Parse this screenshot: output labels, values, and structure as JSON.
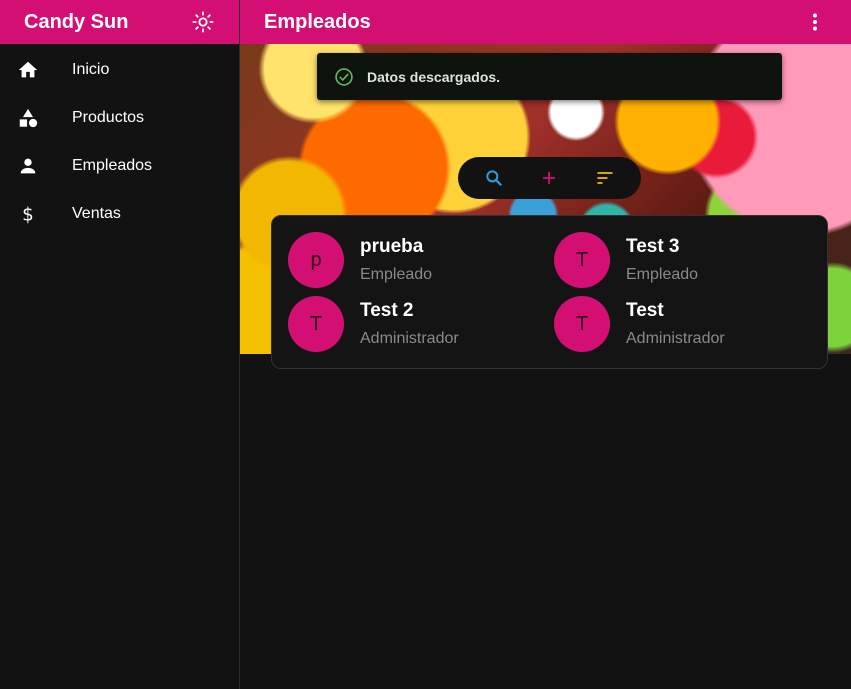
{
  "sidebar": {
    "brand": "Candy Sun",
    "items": [
      {
        "label": "Inicio",
        "icon": "home-icon"
      },
      {
        "label": "Productos",
        "icon": "shapes-icon"
      },
      {
        "label": "Empleados",
        "icon": "person-icon"
      },
      {
        "label": "Ventas",
        "icon": "dollar-icon"
      }
    ]
  },
  "header": {
    "title": "Empleados"
  },
  "toast": {
    "message": "Datos descargados."
  },
  "actions": [
    {
      "name": "search",
      "icon": "search-icon",
      "color": "#2f9ee0"
    },
    {
      "name": "add",
      "icon": "plus-icon",
      "color": "#d40f74"
    },
    {
      "name": "sort",
      "icon": "sort-icon",
      "color": "#e6b800"
    }
  ],
  "employees": [
    {
      "initial": "p",
      "name": "prueba",
      "role": "Empleado"
    },
    {
      "initial": "T",
      "name": "Test 3",
      "role": "Empleado"
    },
    {
      "initial": "T",
      "name": "Test 2",
      "role": "Administrador"
    },
    {
      "initial": "T",
      "name": "Test",
      "role": "Administrador"
    }
  ],
  "colors": {
    "primary": "#d40f74",
    "background": "#121212",
    "success": "#5cb85c"
  }
}
